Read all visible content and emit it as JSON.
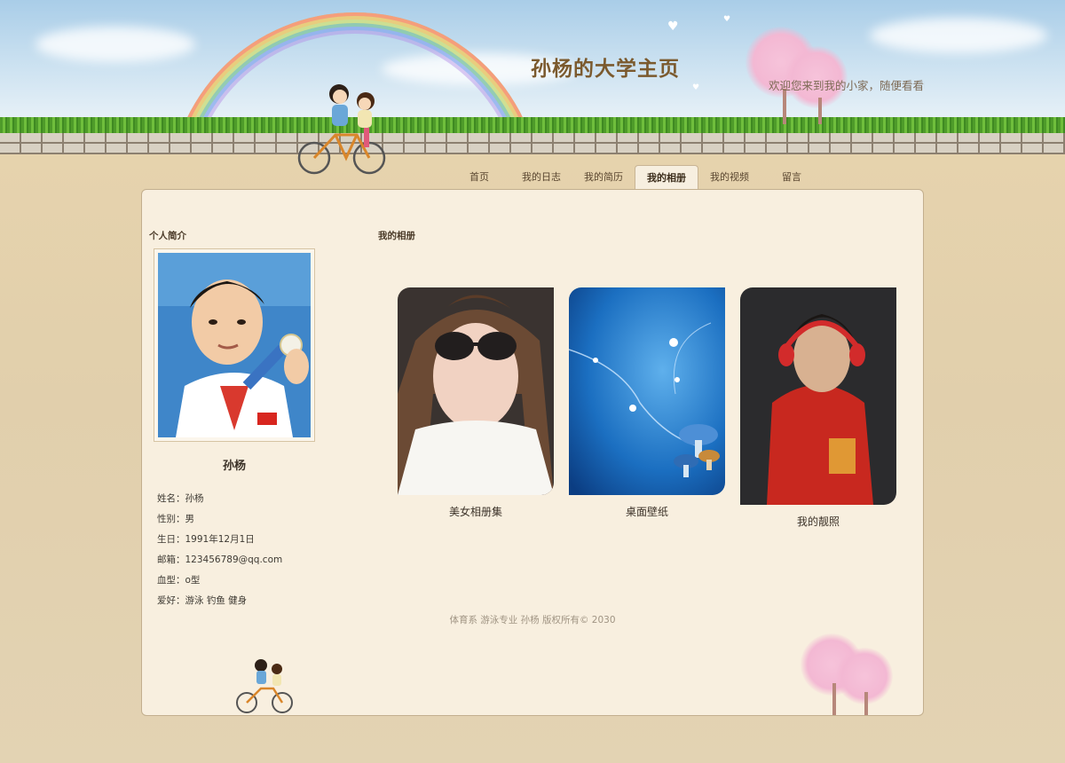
{
  "header": {
    "site_title": "孙杨的大学主页",
    "welcome_text": "欢迎您来到我的小家，随便看看吧"
  },
  "nav": {
    "items": [
      {
        "label": "首页",
        "active": false
      },
      {
        "label": "我的日志",
        "active": false
      },
      {
        "label": "我的简历",
        "active": false
      },
      {
        "label": "我的相册",
        "active": true
      },
      {
        "label": "我的视频",
        "active": false
      },
      {
        "label": "留言",
        "active": false
      }
    ]
  },
  "sidebar": {
    "heading": "个人简介",
    "name": "孙杨",
    "info": [
      "姓名：孙杨",
      "性别：男",
      "生日：1991年12月1日",
      "邮箱：123456789@qq.com",
      "血型：o型",
      "爱好：游泳 钓鱼 健身"
    ]
  },
  "main": {
    "heading": "我的相册",
    "albums": [
      {
        "caption": "美女相册集"
      },
      {
        "caption": "桌面壁纸"
      },
      {
        "caption": "我的靓照"
      }
    ]
  },
  "footer": {
    "text": "体育系 游泳专业   孙杨   版权所有© 2030"
  },
  "colors": {
    "title": "#7b5a2e",
    "panel_bg": "#f8efdf",
    "page_bg": "#e3d3b3",
    "border": "#c3af8e"
  }
}
